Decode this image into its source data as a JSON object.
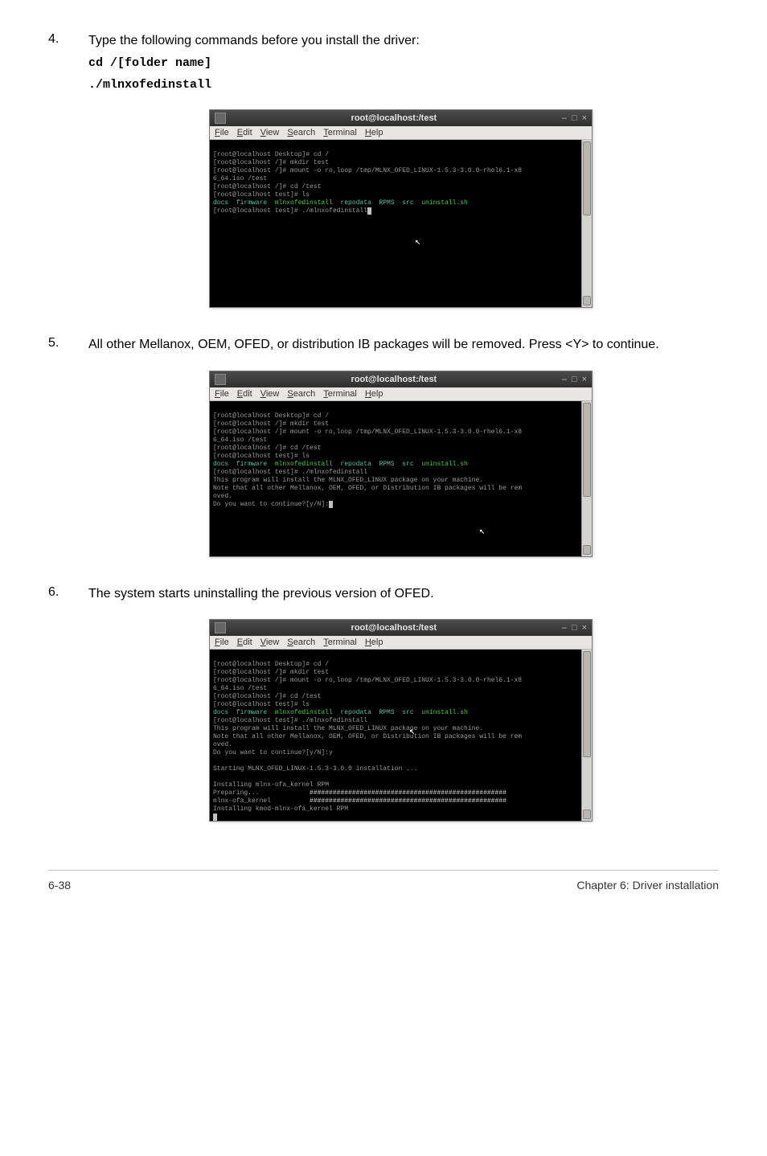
{
  "step4": {
    "num": "4.",
    "text": "Type the following commands before you install the driver:",
    "code1": "cd /[folder name]",
    "code2": "./mlnxofedinstall"
  },
  "step5": {
    "num": "5.",
    "text": "All other Mellanox, OEM, OFED, or distribution IB packages will be removed. Press <Y> to continue."
  },
  "step6": {
    "num": "6.",
    "text": "The system starts uninstalling the previous version of OFED."
  },
  "term": {
    "title": "root@localhost:/test",
    "minimize": "–",
    "maximize": "□",
    "close": "×",
    "menu": {
      "file": "File",
      "edit": "Edit",
      "view": "View",
      "search": "Search",
      "terminal": "Terminal",
      "help": "Help"
    }
  },
  "term1": {
    "l1": "[root@localhost Desktop]# cd /",
    "l2": "[root@localhost /]# mkdir test",
    "l3": "[root@localhost /]# mount -o ro,loop /tmp/MLNX_OFED_LINUX-1.5.3-3.0.0-rhel6.1-x8",
    "l3b": "6_64.iso /test",
    "l4": "[root@localhost /]# cd /test",
    "l5": "[root@localhost test]# ls",
    "l6a": "docs  firmware  ",
    "l6b": "mlnxofedinstall",
    "l6c": "  repodata  ",
    "l6d": "RPMS",
    "l6e": "  src  ",
    "l6f": "uninstall.sh",
    "l7": "[root@localhost test]# ./mlnxofedinstall"
  },
  "term2": {
    "l1": "[root@localhost Desktop]# cd /",
    "l2": "[root@localhost /]# mkdir test",
    "l3": "[root@localhost /]# mount -o ro,loop /tmp/MLNX_OFED_LINUX-1.5.3-3.0.0-rhel6.1-x8",
    "l3b": "6_64.iso /test",
    "l4": "[root@localhost /]# cd /test",
    "l5": "[root@localhost test]# ls",
    "l6a": "docs  firmware  ",
    "l6b": "mlnxofedinstall",
    "l6c": "  repodata  ",
    "l6d": "RPMS",
    "l6e": "  src  ",
    "l6f": "uninstall.sh",
    "l7": "[root@localhost test]# ./mlnxofedinstall",
    "l8": "This program will install the MLNX_OFED_LINUX package on your machine.",
    "l9": "Note that all other Mellanox, OEM, OFED, or Distribution IB packages will be rem",
    "l9b": "oved.",
    "l10": "Do you want to continue?[y/N]:"
  },
  "term3": {
    "l1": "[root@localhost Desktop]# cd /",
    "l2": "[root@localhost /]# mkdir test",
    "l3": "[root@localhost /]# mount -o ro,loop /tmp/MLNX_OFED_LINUX-1.5.3-3.0.0-rhel6.1-x8",
    "l3b": "6_64.iso /test",
    "l4": "[root@localhost /]# cd /test",
    "l5": "[root@localhost test]# ls",
    "l6a": "docs  firmware  ",
    "l6b": "mlnxofedinstall",
    "l6c": "  repodata  ",
    "l6d": "RPMS",
    "l6e": "  src  ",
    "l6f": "uninstall.sh",
    "l7": "[root@localhost test]# ./mlnxofedinstall",
    "l8": "This program will install the MLNX_OFED_LINUX package on your machine.",
    "l9": "Note that all other Mellanox, OEM, OFED, or Distribution IB packages will be rem",
    "l9b": "oved.",
    "l10": "Do you want to continue?[y/N]:y",
    "blank": " ",
    "l11": "Starting MLNX_OFED_LINUX-1.5.3-3.0.0 installation ...",
    "l12": "Installing mlnx-ofa_kernel RPM",
    "l13a": "Preparing...             ",
    "l13b": "###################################################",
    "l14a": "mlnx-ofa_kernel          ",
    "l14b": "###################################################",
    "l15": "Installing kmod-mlnx-ofa_kernel RPM"
  },
  "footer": {
    "left": "6-38",
    "right": "Chapter 6: Driver installation"
  }
}
